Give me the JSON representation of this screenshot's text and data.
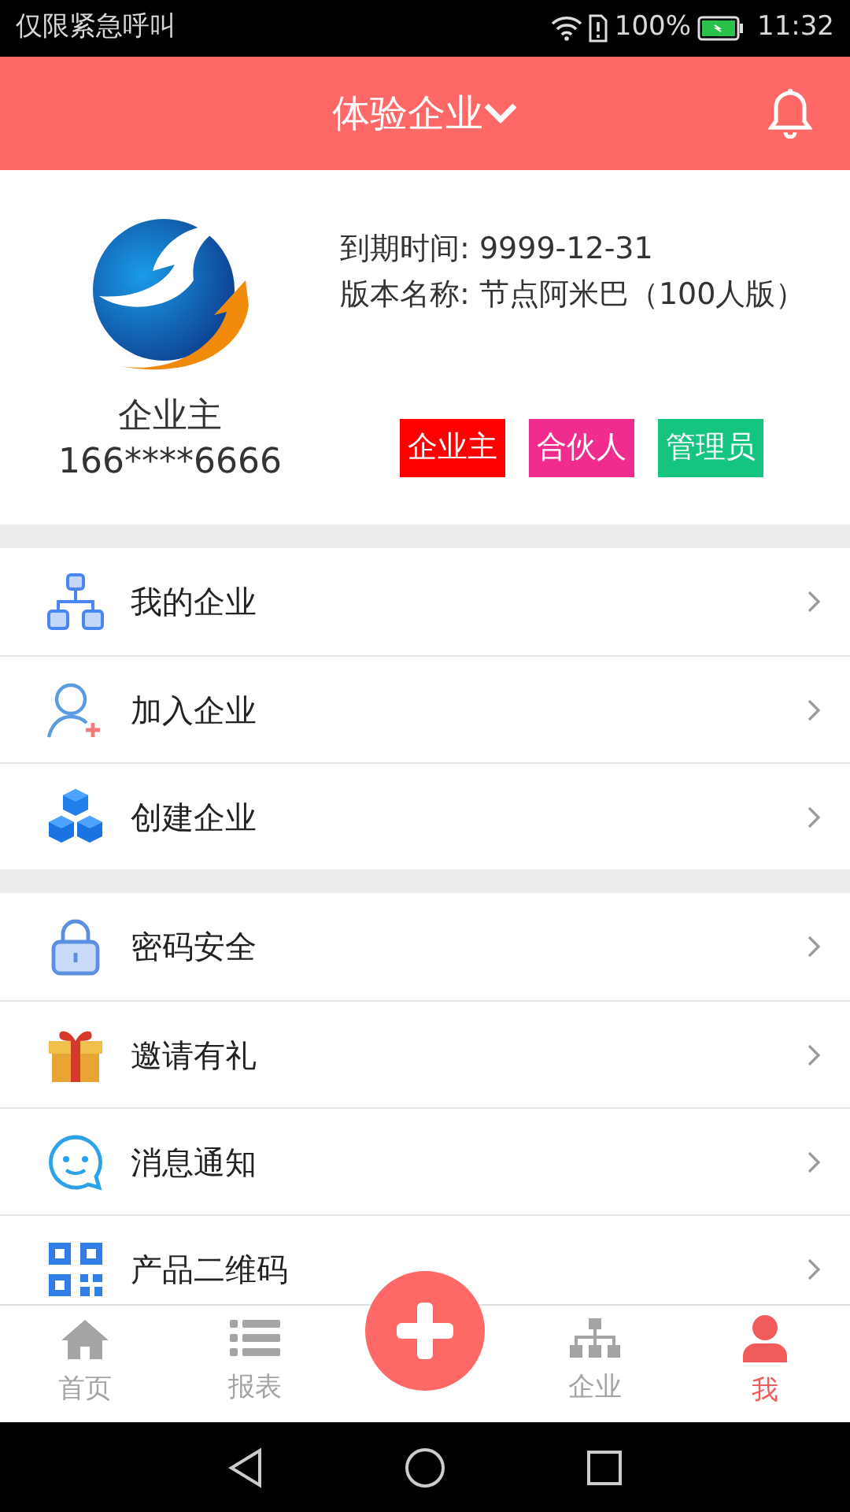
{
  "status_bar": {
    "carrier": "仅限紧急呼叫",
    "battery": "100%",
    "time": "11:32"
  },
  "header": {
    "title": "体验企业"
  },
  "profile": {
    "name": "企业主",
    "phone": "166****6666",
    "expiry": "到期时间: 9999-12-31",
    "version": "版本名称: 节点阿米巴（100人版）",
    "roles": [
      {
        "label": "企业主",
        "color": "#ff0000"
      },
      {
        "label": "合伙人",
        "color": "#f02d8f"
      },
      {
        "label": "管理员",
        "color": "#14c47f"
      }
    ]
  },
  "menu_groups": [
    [
      {
        "label": "我的企业"
      },
      {
        "label": "加入企业"
      },
      {
        "label": "创建企业"
      }
    ],
    [
      {
        "label": "密码安全"
      },
      {
        "label": "邀请有礼"
      },
      {
        "label": "消息通知"
      },
      {
        "label": "产品二维码"
      }
    ]
  ],
  "tabs": [
    {
      "label": "首页",
      "selected": false
    },
    {
      "label": "报表",
      "selected": false
    },
    {
      "label": "企业",
      "selected": false
    },
    {
      "label": "我",
      "selected": true
    }
  ]
}
